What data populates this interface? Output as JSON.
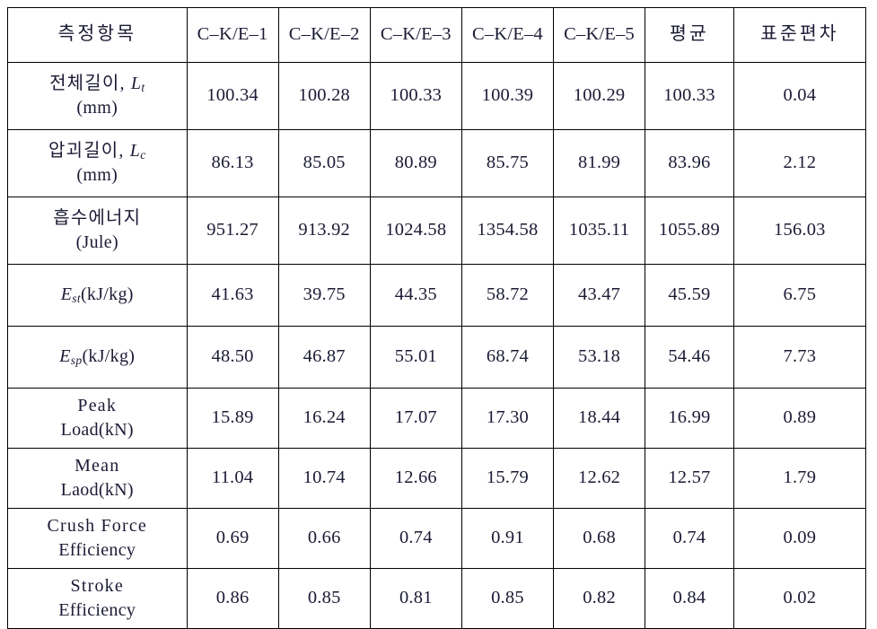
{
  "table": {
    "columns": [
      {
        "key": "label",
        "header": "측정항목",
        "type": "label"
      },
      {
        "key": "s1",
        "header": "C‒K/E‒1",
        "type": "spec"
      },
      {
        "key": "s2",
        "header": "C‒K/E‒2",
        "type": "spec"
      },
      {
        "key": "s3",
        "header": "C‒K/E‒3",
        "type": "spec"
      },
      {
        "key": "s4",
        "header": "C‒K/E‒4",
        "type": "spec"
      },
      {
        "key": "s5",
        "header": "C‒K/E‒5",
        "type": "spec"
      },
      {
        "key": "avg",
        "header": "평균",
        "type": "avg"
      },
      {
        "key": "sd",
        "header": "표준편차",
        "type": "sd"
      }
    ],
    "rows": [
      {
        "label_line1_ko": "전체길이, ",
        "label_sym": "L",
        "label_sub": "t",
        "label_line2": "(mm)",
        "label_plain": "전체길이, Lt (mm)",
        "values": [
          "100.34",
          "100.28",
          "100.33",
          "100.39",
          "100.29",
          "100.33",
          "0.04"
        ]
      },
      {
        "label_line1_ko": "압괴길이, ",
        "label_sym": "L",
        "label_sub": "c",
        "label_line2": "(mm)",
        "label_plain": "압괴길이, Lc (mm)",
        "values": [
          "86.13",
          "85.05",
          "80.89",
          "85.75",
          "81.99",
          "83.96",
          "2.12"
        ]
      },
      {
        "label_line1_ko": "흡수에너지",
        "label_sym": "",
        "label_sub": "",
        "label_line2": "(Jule)",
        "label_plain": "흡수에너지 (Jule)",
        "values": [
          "951.27",
          "913.92",
          "1024.58",
          "1354.58",
          "1035.11",
          "1055.89",
          "156.03"
        ]
      },
      {
        "label_line1_ko": "",
        "label_sym": "E",
        "label_sub": "st",
        "label_line2": "",
        "label_inline_unit": "(kJ/kg)",
        "label_plain": "Est(kJ/kg)",
        "values": [
          "41.63",
          "39.75",
          "44.35",
          "58.72",
          "43.47",
          "45.59",
          "6.75"
        ]
      },
      {
        "label_line1_ko": "",
        "label_sym": "E",
        "label_sub": "sp",
        "label_line2": "",
        "label_inline_unit": "(kJ/kg)",
        "label_plain": "Esp(kJ/kg)",
        "values": [
          "48.50",
          "46.87",
          "55.01",
          "68.74",
          "53.18",
          "54.46",
          "7.73"
        ]
      },
      {
        "label_line1_ko": "Peak",
        "label_sym": "",
        "label_sub": "",
        "label_line2": "Load(kN)",
        "label_plain": "Peak Load(kN)",
        "values": [
          "15.89",
          "16.24",
          "17.07",
          "17.30",
          "18.44",
          "16.99",
          "0.89"
        ]
      },
      {
        "label_line1_ko": "Mean",
        "label_sym": "",
        "label_sub": "",
        "label_line2": "Laod(kN)",
        "label_plain": "Mean Laod(kN)",
        "values": [
          "11.04",
          "10.74",
          "12.66",
          "15.79",
          "12.62",
          "12.57",
          "1.79"
        ]
      },
      {
        "label_line1_ko": "Crush  Force",
        "label_sym": "",
        "label_sub": "",
        "label_line2": "Efficiency",
        "label_plain": "Crush Force Efficiency",
        "values": [
          "0.69",
          "0.66",
          "0.74",
          "0.91",
          "0.68",
          "0.74",
          "0.09"
        ]
      },
      {
        "label_line1_ko": "Stroke",
        "label_sym": "",
        "label_sub": "",
        "label_line2": "Efficiency",
        "label_plain": "Stroke Efficiency",
        "values": [
          "0.86",
          "0.85",
          "0.81",
          "0.85",
          "0.82",
          "0.84",
          "0.02"
        ]
      }
    ]
  }
}
